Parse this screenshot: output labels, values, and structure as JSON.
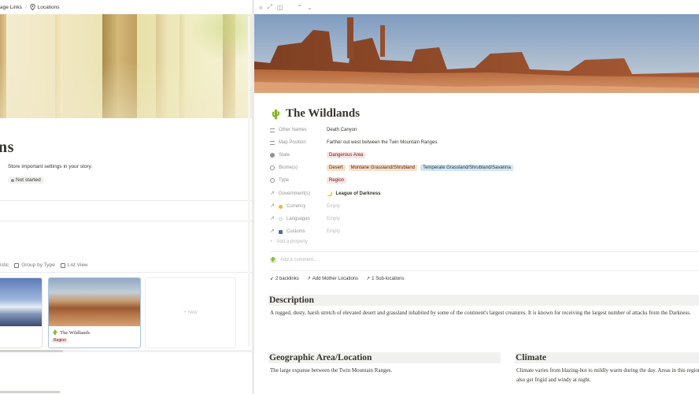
{
  "left": {
    "breadcrumb": {
      "page_links": "age Links",
      "separator": "/",
      "locations": "Locations"
    },
    "title": "ns",
    "description": "Store important settings in your story.",
    "status": "Not started",
    "views": [
      "istic",
      "Group by Type",
      "List View"
    ],
    "cards": [
      {
        "title": "",
        "tag": ""
      },
      {
        "title": "The Wildlands",
        "tag": "Region"
      }
    ],
    "new_label": "New"
  },
  "right": {
    "toolbar_icons": [
      "expand-icon",
      "fullscreen-icon",
      "sidebar-peek-icon",
      "arrow-up-icon",
      "arrow-down-icon"
    ],
    "title": "The Wildlands",
    "properties": [
      {
        "name": "Other Names",
        "icon": "list-icon",
        "value": "Death Canyon"
      },
      {
        "name": "Map Position",
        "icon": "list-icon",
        "value": "Farther out west between the Twin Mountain Ranges."
      },
      {
        "name": "State",
        "icon": "status-icon",
        "chips": [
          {
            "label": "Dangerous Area",
            "color": "red"
          }
        ]
      },
      {
        "name": "Biome(s)",
        "icon": "multi-select-icon",
        "chips": [
          {
            "label": "Desert",
            "color": "orange"
          },
          {
            "label": "Montane Grassland/Shrubland",
            "color": "orange"
          },
          {
            "label": "Temperate Grassland/Shrubland/Savanna",
            "color": "blue"
          }
        ]
      },
      {
        "name": "Type",
        "icon": "select-icon",
        "chips": [
          {
            "label": "Region",
            "color": "red"
          }
        ]
      },
      {
        "name": "Government(s)",
        "icon": "relation-icon",
        "value": "League of Darkness"
      },
      {
        "name": "Currency",
        "icon": "relation-icon",
        "value": "Empty",
        "empty": true
      },
      {
        "name": "Languages",
        "icon": "relation-icon",
        "value": "Empty",
        "empty": true
      },
      {
        "name": "Customs",
        "icon": "relation-icon",
        "value": "Empty",
        "empty": true
      }
    ],
    "add_property": "Add a property",
    "add_comment": "Add a comment...",
    "links": {
      "backlinks": "2 backlinks",
      "mother": "Add Mother Locations",
      "sub": "1 Sub-locations"
    },
    "description": {
      "heading": "Description",
      "text": "A rugged, dusty, harsh stretch of elevated desert and grassland inhabited by some of the continent's largest creatures. It is known for receiving the largest number of attacks from the Darkness."
    },
    "geo": {
      "heading": "Geographic Area/Location",
      "text": "The large expanse between the Twin Mountain Ranges."
    },
    "climate": {
      "heading": "Climate",
      "text": "Climate varies from blazing-hot to mildly warm during the day. Areas in this region also get frigid and windy at night."
    }
  }
}
